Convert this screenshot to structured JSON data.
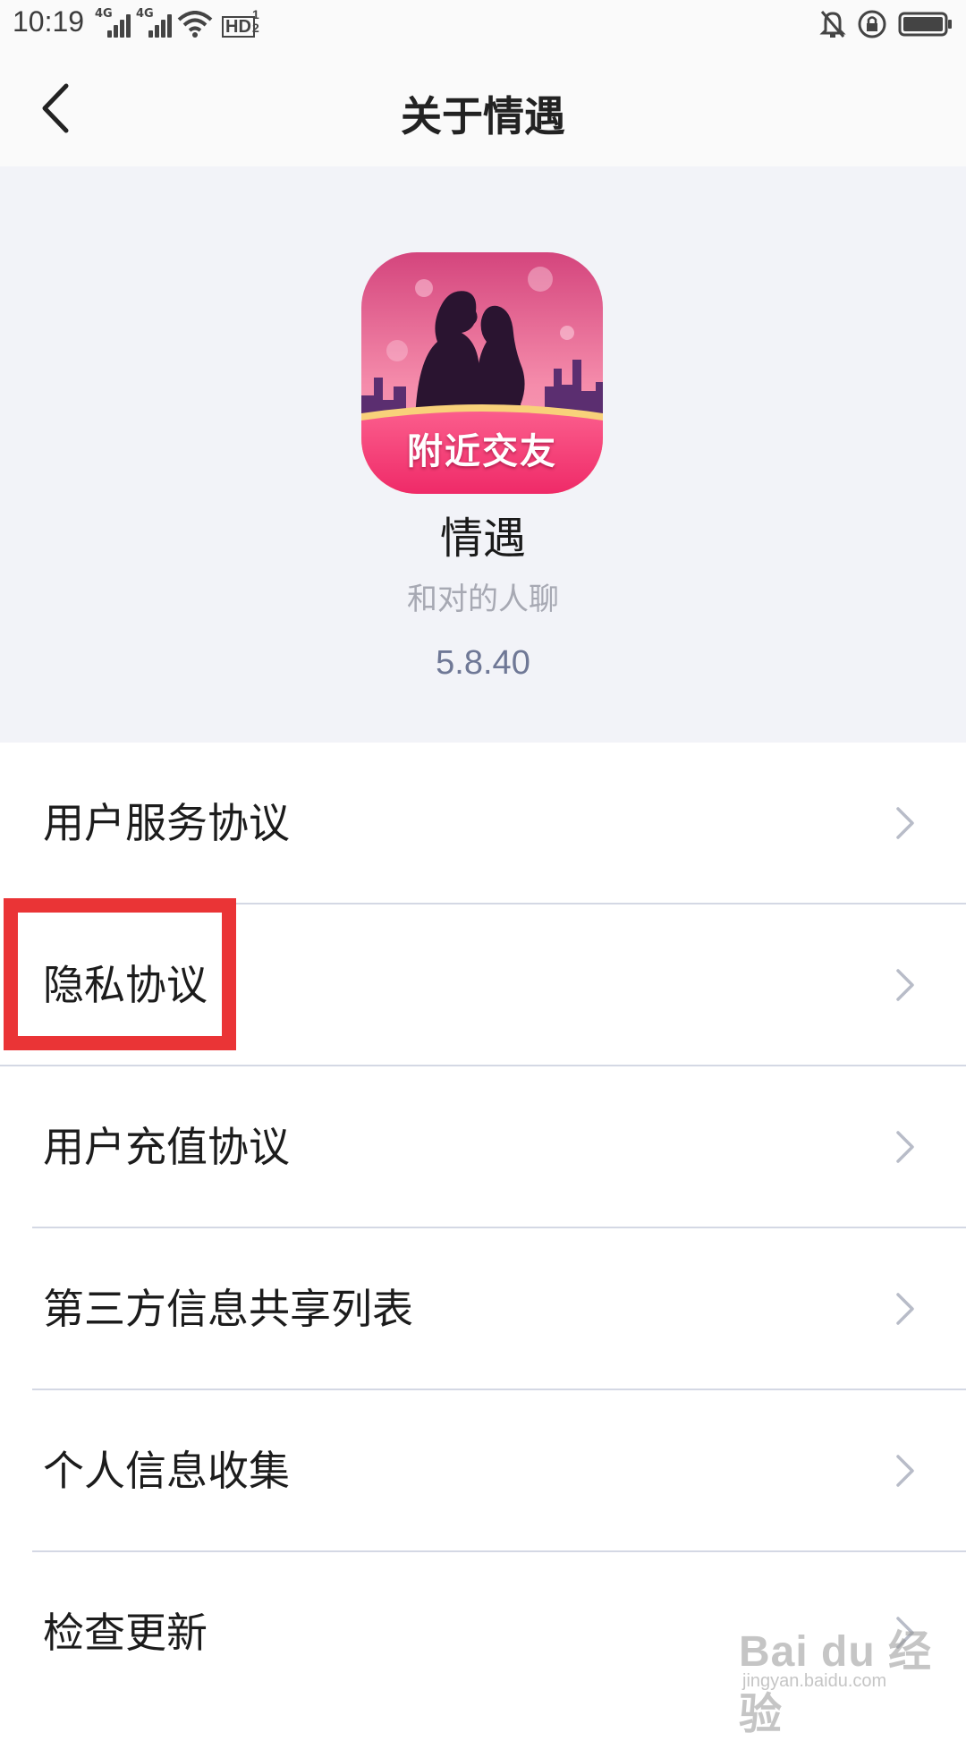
{
  "status_bar": {
    "time": "10:19",
    "network_1": "4G",
    "network_2": "4G",
    "hd_label": "HD",
    "hd_sim_1": "1",
    "hd_sim_2": "2"
  },
  "header": {
    "back_icon": "chevron-left-icon",
    "title": "关于情遇"
  },
  "app_info": {
    "logo_caption": "附近交友",
    "name": "情遇",
    "slogan": "和对的人聊",
    "version": "5.8.40"
  },
  "menu": {
    "items": [
      {
        "label": "用户服务协议",
        "icon": "chevron-right-icon"
      },
      {
        "label": "隐私协议",
        "icon": "chevron-right-icon",
        "highlighted": true
      },
      {
        "label": "用户充值协议",
        "icon": "chevron-right-icon"
      },
      {
        "label": "第三方信息共享列表",
        "icon": "chevron-right-icon"
      },
      {
        "label": "个人信息收集",
        "icon": "chevron-right-icon"
      },
      {
        "label": "检查更新",
        "icon": "chevron-right-icon"
      }
    ]
  },
  "watermark": {
    "main": "Bai du 经验",
    "sub": "jingyan.baidu.com"
  },
  "colors": {
    "highlight": "#ea3436",
    "hero_background": "#f2f3f8",
    "version_text": "#6f7896",
    "slogan_text": "#a7a9b3",
    "divider": "#d4d8e4"
  }
}
